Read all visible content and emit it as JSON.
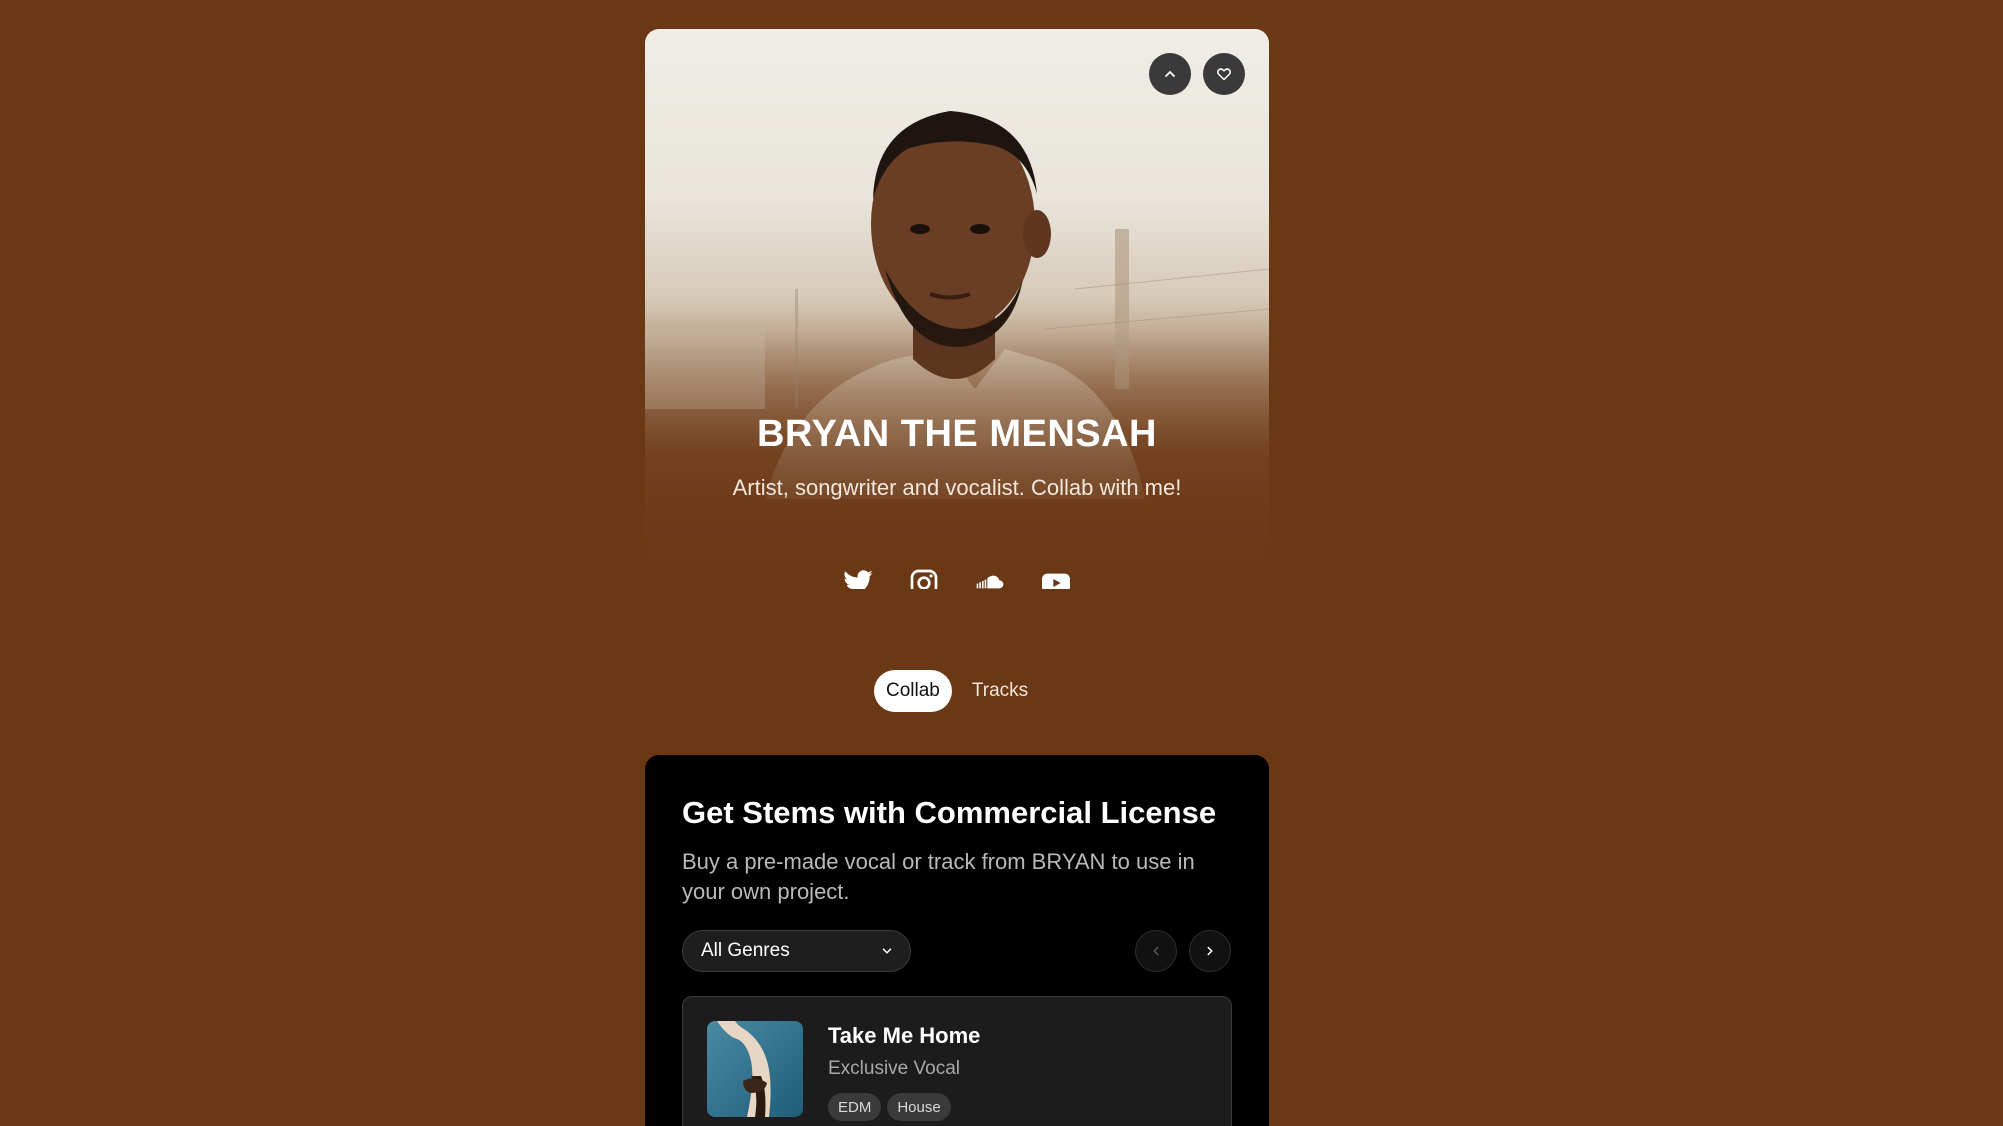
{
  "profile": {
    "name": "BRYAN THE MENSAH",
    "bio": "Artist, songwriter and vocalist. Collab with me!",
    "actions": [
      {
        "icon": "chevron-up-icon"
      },
      {
        "icon": "heart-icon"
      }
    ],
    "socials": [
      {
        "icon": "twitter-icon"
      },
      {
        "icon": "instagram-icon"
      },
      {
        "icon": "soundcloud-icon"
      },
      {
        "icon": "youtube-icon"
      }
    ]
  },
  "tabs": [
    {
      "label": "Collab",
      "active": true
    },
    {
      "label": "Tracks",
      "active": false
    }
  ],
  "stems": {
    "title": "Get Stems with Commercial License",
    "description": "Buy a pre-made vocal or track from BRYAN to use in your own project.",
    "genre_filter": {
      "selected": "All Genres"
    },
    "tracks": [
      {
        "title": "Take Me Home",
        "type": "Exclusive Vocal",
        "tags": [
          "EDM",
          "House"
        ]
      }
    ]
  },
  "colors": {
    "page_background": "#6b3816",
    "card_background": "#000000",
    "active_tab": "#ffffff"
  }
}
